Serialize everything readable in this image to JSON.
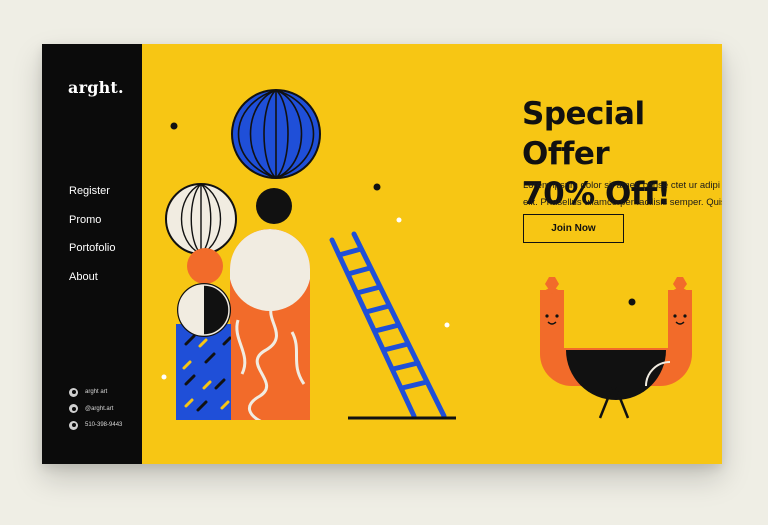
{
  "brand": {
    "logo": "arght."
  },
  "nav": {
    "items": [
      "Register",
      "Promo",
      "Portofolio",
      "About"
    ]
  },
  "hero": {
    "headline_line1": "Special Offer",
    "headline_line2": "70% Off!",
    "body_line1": "Lorem ipsum dolor sit amet, conse ctet ur adipi scing",
    "body_line2": "elit. Phasellus ullamcorper facilisis semper. Quisque",
    "cta": "Join Now"
  },
  "social": [
    {
      "icon": "facebook-icon",
      "label": "arght art"
    },
    {
      "icon": "instagram-icon",
      "label": "@arght.art"
    },
    {
      "icon": "whatsapp-icon",
      "label": "510-398-9443"
    }
  ],
  "colors": {
    "background": "#f7c614",
    "sidebar": "#0b0b0b",
    "accent_orange": "#f26b2a",
    "accent_blue": "#1f4fd8",
    "cream": "#f1ece1",
    "ink": "#111111"
  }
}
